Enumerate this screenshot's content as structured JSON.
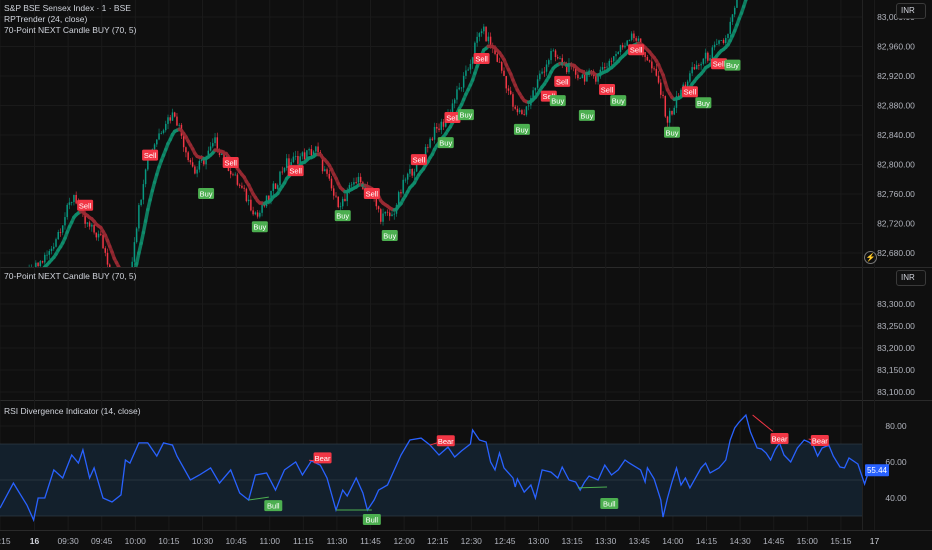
{
  "header": {
    "symbol_title": "S&P BSE Sensex Index · 1 · BSE",
    "indicator_1": "RPTrender (24, close)",
    "indicator_2": "70-Point NEXT Candle BUY (70, 5)"
  },
  "pane2": {
    "title": "70-Point NEXT Candle BUY (70, 5)"
  },
  "pane3": {
    "title": "RSI Divergence Indicator (14, close)"
  },
  "currency_label": "INR",
  "colors": {
    "up": "#089981",
    "down": "#f23645",
    "trend_up": "#0e8f6e",
    "trend_down": "#9c2a33",
    "rsi": "#2962ff",
    "bull": "#4caf50",
    "bear": "#f23645"
  },
  "chart_data": [
    {
      "type": "candlestick",
      "title": "S&P BSE Sensex Index · 1 · BSE",
      "x_unit": "bar index (1-minute bars)",
      "ylim": [
        82660,
        83030
      ],
      "y_ticks": [
        "83,000.00",
        "82,960.00",
        "82,920.00",
        "82,880.00",
        "82,840.00",
        "82,800.00",
        "82,760.00",
        "82,720.00",
        "82,680.00"
      ],
      "y_tick_values": [
        83000,
        82960,
        82920,
        82880,
        82840,
        82800,
        82760,
        82720,
        82680
      ],
      "close_points": [
        [
          0,
          82640
        ],
        [
          4,
          82620
        ],
        [
          13,
          82650
        ],
        [
          22,
          82680
        ],
        [
          29,
          82730
        ],
        [
          33,
          82760
        ],
        [
          38,
          82720
        ],
        [
          45,
          82700
        ],
        [
          51,
          82640
        ],
        [
          57,
          82620
        ],
        [
          60,
          82700
        ],
        [
          65,
          82800
        ],
        [
          69,
          82830
        ],
        [
          74,
          82860
        ],
        [
          78,
          82870
        ],
        [
          83,
          82820
        ],
        [
          87,
          82790
        ],
        [
          92,
          82810
        ],
        [
          96,
          82830
        ],
        [
          100,
          82810
        ],
        [
          105,
          82780
        ],
        [
          109,
          82760
        ],
        [
          115,
          82730
        ],
        [
          121,
          82760
        ],
        [
          127,
          82800
        ],
        [
          134,
          82810
        ],
        [
          141,
          82820
        ],
        [
          145,
          82790
        ],
        [
          150,
          82750
        ],
        [
          154,
          82750
        ],
        [
          158,
          82780
        ],
        [
          164,
          82770
        ],
        [
          170,
          82730
        ],
        [
          175,
          82730
        ],
        [
          181,
          82780
        ],
        [
          188,
          82810
        ],
        [
          193,
          82840
        ],
        [
          199,
          82860
        ],
        [
          203,
          82890
        ],
        [
          208,
          82920
        ],
        [
          212,
          82960
        ],
        [
          215,
          82985
        ],
        [
          221,
          82950
        ],
        [
          225,
          82920
        ],
        [
          230,
          82870
        ],
        [
          234,
          82870
        ],
        [
          241,
          82920
        ],
        [
          246,
          82950
        ],
        [
          250,
          82940
        ],
        [
          254,
          82930
        ],
        [
          259,
          82920
        ],
        [
          266,
          82920
        ],
        [
          272,
          82940
        ],
        [
          278,
          82960
        ],
        [
          282,
          82980
        ],
        [
          288,
          82950
        ],
        [
          294,
          82910
        ],
        [
          298,
          82860
        ],
        [
          304,
          82900
        ],
        [
          310,
          82930
        ],
        [
          317,
          82950
        ],
        [
          324,
          82970
        ],
        [
          328,
          83010
        ],
        [
          333,
          83060
        ],
        [
          339,
          83100
        ]
      ],
      "signals": [
        {
          "label": "Sell",
          "bar": 38,
          "price": 82744
        },
        {
          "label": "Sell",
          "bar": 67,
          "price": 82812
        },
        {
          "label": "Buy",
          "bar": 92,
          "price": 82760
        },
        {
          "label": "Sell",
          "bar": 103,
          "price": 82802
        },
        {
          "label": "Buy",
          "bar": 116,
          "price": 82715
        },
        {
          "label": "Sell",
          "bar": 132,
          "price": 82791
        },
        {
          "label": "Buy",
          "bar": 153,
          "price": 82730
        },
        {
          "label": "Sell",
          "bar": 166,
          "price": 82760
        },
        {
          "label": "Buy",
          "bar": 174,
          "price": 82703
        },
        {
          "label": "Sell",
          "bar": 187,
          "price": 82806
        },
        {
          "label": "Buy",
          "bar": 199,
          "price": 82829
        },
        {
          "label": "Sell",
          "bar": 202,
          "price": 82863
        },
        {
          "label": "Buy",
          "bar": 208,
          "price": 82867
        },
        {
          "label": "Sell",
          "bar": 215,
          "price": 82943
        },
        {
          "label": "Buy",
          "bar": 233,
          "price": 82847
        },
        {
          "label": "Sell",
          "bar": 245,
          "price": 82892
        },
        {
          "label": "Buy",
          "bar": 249,
          "price": 82886
        },
        {
          "label": "Sell",
          "bar": 251,
          "price": 82912
        },
        {
          "label": "Buy",
          "bar": 262,
          "price": 82866
        },
        {
          "label": "Sell",
          "bar": 271,
          "price": 82901
        },
        {
          "label": "Buy",
          "bar": 276,
          "price": 82886
        },
        {
          "label": "Sell",
          "bar": 284,
          "price": 82955
        },
        {
          "label": "Buy",
          "bar": 300,
          "price": 82843
        },
        {
          "label": "Sell",
          "bar": 308,
          "price": 82898
        },
        {
          "label": "Buy",
          "bar": 314,
          "price": 82883
        },
        {
          "label": "Sell",
          "bar": 321,
          "price": 82936
        },
        {
          "label": "Buy",
          "bar": 327,
          "price": 82934
        }
      ]
    },
    {
      "type": "line",
      "title": "70-Point NEXT Candle BUY (70, 5)",
      "y_ticks": [
        "83,300.00",
        "83,250.00",
        "83,200.00",
        "83,150.00",
        "83,100.00"
      ],
      "y_tick_values": [
        83300,
        83250,
        83200,
        83150,
        83100
      ],
      "ylim": [
        83080,
        83330
      ]
    },
    {
      "type": "line",
      "title": "RSI Divergence Indicator (14, close)",
      "ylim": [
        27,
        92
      ],
      "band": [
        30,
        70
      ],
      "midline": 50,
      "y_ticks": [
        "80.00",
        "60.00",
        "40.00"
      ],
      "y_tick_values": [
        80,
        60,
        40
      ],
      "last_value": "55.44",
      "rsi_points": [
        [
          0,
          34.4
        ],
        [
          6,
          48.3
        ],
        [
          12,
          36.1
        ],
        [
          15,
          27.8
        ],
        [
          17,
          40
        ],
        [
          20,
          40
        ],
        [
          24,
          55.6
        ],
        [
          28,
          51.1
        ],
        [
          32,
          63.9
        ],
        [
          35,
          59.4
        ],
        [
          37,
          66.7
        ],
        [
          40,
          51.1
        ],
        [
          42,
          56.7
        ],
        [
          46,
          40
        ],
        [
          50,
          37.8
        ],
        [
          54,
          41.7
        ],
        [
          56,
          61.1
        ],
        [
          58,
          59.4
        ],
        [
          62,
          70.6
        ],
        [
          66,
          70.6
        ],
        [
          70,
          63.3
        ],
        [
          73,
          70.6
        ],
        [
          77,
          69.4
        ],
        [
          79,
          63.3
        ],
        [
          85,
          50
        ],
        [
          89,
          52.8
        ],
        [
          94,
          56.7
        ],
        [
          98,
          48.3
        ],
        [
          103,
          55.6
        ],
        [
          107,
          42.8
        ],
        [
          111,
          38.9
        ],
        [
          114,
          52.8
        ],
        [
          119,
          53.9
        ],
        [
          123,
          44.4
        ],
        [
          127,
          55.6
        ],
        [
          132,
          60
        ],
        [
          135,
          52.8
        ],
        [
          139,
          60.6
        ],
        [
          143,
          58.3
        ],
        [
          146,
          51.1
        ],
        [
          150,
          33.3
        ],
        [
          153,
          44.4
        ],
        [
          155,
          41.1
        ],
        [
          159,
          51.1
        ],
        [
          162,
          42.8
        ],
        [
          164,
          33.3
        ],
        [
          167,
          38.9
        ],
        [
          169,
          44.4
        ],
        [
          173,
          47.2
        ],
        [
          179,
          63.9
        ],
        [
          183,
          72.2
        ],
        [
          188,
          73.3
        ],
        [
          192,
          69.4
        ],
        [
          196,
          63.9
        ],
        [
          200,
          68.3
        ],
        [
          203,
          62.8
        ],
        [
          206,
          66.1
        ],
        [
          210,
          70
        ],
        [
          211,
          77.8
        ],
        [
          214,
          72.2
        ],
        [
          217,
          71.1
        ],
        [
          219,
          60
        ],
        [
          221,
          55.6
        ],
        [
          223,
          65
        ],
        [
          225,
          56.7
        ],
        [
          229,
          51.1
        ],
        [
          230,
          46.1
        ],
        [
          231,
          50.6
        ],
        [
          234,
          43.3
        ],
        [
          237,
          47.2
        ],
        [
          239,
          40
        ],
        [
          242,
          55.6
        ],
        [
          246,
          54.4
        ],
        [
          249,
          51.1
        ],
        [
          251,
          57.2
        ],
        [
          254,
          50
        ],
        [
          257,
          48.9
        ],
        [
          259,
          44.4
        ],
        [
          261,
          48.9
        ],
        [
          263,
          52.2
        ],
        [
          267,
          50
        ],
        [
          270,
          58.3
        ],
        [
          273,
          52.8
        ],
        [
          276,
          55.6
        ],
        [
          279,
          61.1
        ],
        [
          281,
          59.4
        ],
        [
          286,
          55.6
        ],
        [
          288,
          48.9
        ],
        [
          289,
          56.7
        ],
        [
          292,
          50.6
        ],
        [
          295,
          38.9
        ],
        [
          296,
          29.4
        ],
        [
          298,
          40
        ],
        [
          300,
          48.9
        ],
        [
          302,
          56.7
        ],
        [
          304,
          47.2
        ],
        [
          306,
          51.1
        ],
        [
          308,
          45.6
        ],
        [
          313,
          56.7
        ],
        [
          315,
          59.4
        ],
        [
          317,
          53.9
        ],
        [
          321,
          56.7
        ],
        [
          324,
          61.1
        ],
        [
          326,
          72.2
        ],
        [
          328,
          78.9
        ],
        [
          330,
          82.2
        ],
        [
          333,
          86.1
        ],
        [
          335,
          76.7
        ],
        [
          338,
          67.8
        ],
        [
          340,
          67.2
        ],
        [
          342,
          65
        ],
        [
          344,
          61.1
        ],
        [
          346,
          66.7
        ],
        [
          348,
          70.6
        ],
        [
          350,
          63.9
        ],
        [
          353,
          60
        ],
        [
          356,
          67.8
        ],
        [
          359,
          72.2
        ],
        [
          361,
          71.1
        ],
        [
          363,
          69.4
        ],
        [
          365,
          63.3
        ],
        [
          367,
          67.8
        ],
        [
          370,
          69.4
        ],
        [
          372,
          63.3
        ],
        [
          375,
          57.2
        ],
        [
          377,
          56.7
        ],
        [
          379,
          62.2
        ],
        [
          383,
          58.9
        ],
        [
          386,
          47.8
        ],
        [
          388,
          55.44
        ]
      ],
      "divergences": [
        {
          "label": "Bull",
          "from": [
            111,
            38.9
          ],
          "to": [
            120,
            40.5
          ],
          "label_at": [
            122,
            35.5
          ]
        },
        {
          "label": "Bear",
          "from": [
            138,
            61
          ],
          "to": [
            142,
            60.5
          ],
          "label_at": [
            144,
            62
          ]
        },
        {
          "label": "Bull",
          "from": [
            150,
            33.3
          ],
          "to": [
            166,
            33.3
          ],
          "label_at": [
            166,
            27.8
          ]
        },
        {
          "label": "Bear",
          "from": [
            192,
            69.4
          ],
          "to": [
            196,
            71
          ],
          "label_at": [
            199,
            71.5
          ]
        },
        {
          "label": "Bull",
          "from": [
            258,
            45.6
          ],
          "to": [
            271,
            46.1
          ],
          "label_at": [
            272,
            36.7
          ]
        },
        {
          "label": "Bear",
          "from": [
            336,
            86.1
          ],
          "to": [
            345,
            77
          ],
          "label_at": [
            348,
            72.8
          ]
        },
        {
          "label": "Bear",
          "from": [
            361,
            72.8
          ],
          "to": [
            363,
            72.2
          ],
          "label_at": [
            366,
            71.7
          ]
        }
      ]
    }
  ],
  "x_ticks": [
    {
      "label": "15:15",
      "bar": 0
    },
    {
      "label": "16",
      "bar": 15.4
    },
    {
      "label": "09:30",
      "bar": 30.4
    },
    {
      "label": "09:45",
      "bar": 45.4
    },
    {
      "label": "10:00",
      "bar": 60.4
    },
    {
      "label": "10:15",
      "bar": 75.4
    },
    {
      "label": "10:30",
      "bar": 90.4
    },
    {
      "label": "10:45",
      "bar": 105.4
    },
    {
      "label": "11:00",
      "bar": 120.4
    },
    {
      "label": "11:15",
      "bar": 135.4
    },
    {
      "label": "11:30",
      "bar": 150.4
    },
    {
      "label": "11:45",
      "bar": 165.4
    },
    {
      "label": "12:00",
      "bar": 180.4
    },
    {
      "label": "12:15",
      "bar": 195.4
    },
    {
      "label": "12:30",
      "bar": 210.4
    },
    {
      "label": "12:45",
      "bar": 225.4
    },
    {
      "label": "13:00",
      "bar": 240.4
    },
    {
      "label": "13:15",
      "bar": 255.4
    },
    {
      "label": "13:30",
      "bar": 270.4
    },
    {
      "label": "13:45",
      "bar": 285.4
    },
    {
      "label": "14:00",
      "bar": 300.4
    },
    {
      "label": "14:15",
      "bar": 315.4
    },
    {
      "label": "14:30",
      "bar": 330.4
    },
    {
      "label": "14:45",
      "bar": 345.4
    },
    {
      "label": "15:00",
      "bar": 360.4
    },
    {
      "label": "15:15",
      "bar": 375.4
    },
    {
      "label": "17",
      "bar": 390.4
    }
  ]
}
